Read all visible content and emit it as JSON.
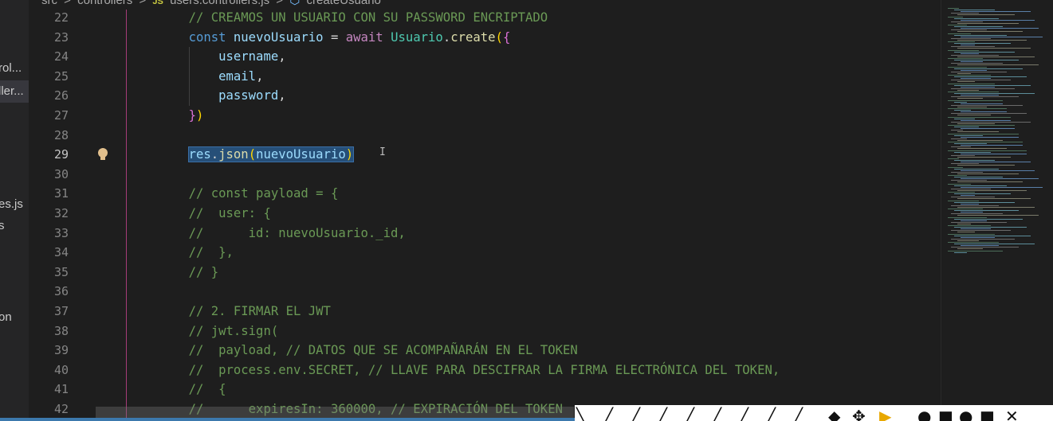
{
  "breadcrumb": {
    "items": [
      "src",
      "controllers",
      "users.controllers.js",
      "createUsuario"
    ],
    "separator": ">",
    "file_badge": "JS",
    "symbol_icon": "cube-icon"
  },
  "sidebar": {
    "items": [
      "rol...",
      "ller...",
      "es.js",
      "s",
      "on"
    ]
  },
  "editor": {
    "active_line": 29,
    "lines": [
      {
        "n": 22,
        "t": "    // CREAMOS UN USUARIO CON SU PASSWORD ENCRIPTADO"
      },
      {
        "n": 23,
        "t": "    const nuevoUsuario = await Usuario.create({"
      },
      {
        "n": 24,
        "t": "        username,"
      },
      {
        "n": 25,
        "t": "        email,"
      },
      {
        "n": 26,
        "t": "        password,"
      },
      {
        "n": 27,
        "t": "    })"
      },
      {
        "n": 28,
        "t": ""
      },
      {
        "n": 29,
        "t": "    res.json(nuevoUsuario)"
      },
      {
        "n": 30,
        "t": ""
      },
      {
        "n": 31,
        "t": "    // const payload = {"
      },
      {
        "n": 32,
        "t": "    //  user: {"
      },
      {
        "n": 33,
        "t": "    //      id: nuevoUsuario._id,"
      },
      {
        "n": 34,
        "t": "    //  },"
      },
      {
        "n": 35,
        "t": "    // }"
      },
      {
        "n": 36,
        "t": ""
      },
      {
        "n": 37,
        "t": "    // 2. FIRMAR EL JWT"
      },
      {
        "n": 38,
        "t": "    // jwt.sign("
      },
      {
        "n": 39,
        "t": "    //  payload, // DATOS QUE SE ACOMPAÑARÁN EN EL TOKEN"
      },
      {
        "n": 40,
        "t": "    //  process.env.SECRET, // LLAVE PARA DESCIFRAR LA FIRMA ELECTRÓNICA DEL TOKEN,"
      },
      {
        "n": 41,
        "t": "    //  {"
      },
      {
        "n": 42,
        "t": "    //      expiresIn: 360000, // EXPIRACIÓN DEL TOKEN"
      }
    ]
  },
  "colors": {
    "background": "#1e1e1e",
    "keyword": "#569cd6",
    "variable": "#9cdcfe",
    "class": "#4ec9b0",
    "function": "#dcdcaa",
    "comment": "#6a9955",
    "selection": "#264f78"
  },
  "icons": [
    "lightbulb-icon",
    "text-cursor-icon",
    "cube-icon"
  ]
}
